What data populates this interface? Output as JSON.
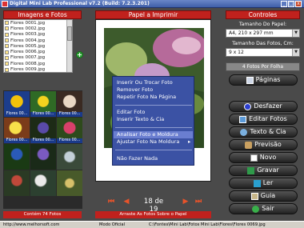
{
  "window": {
    "title": "Digital Mini Lab Professional v7.2 (Build: 7.2.3.201)",
    "btn_min": "_",
    "btn_max": "□",
    "btn_close": "x"
  },
  "left": {
    "header": "Imagens e Fotos",
    "files": [
      "Flores 0001.jpg",
      "Flores 0002.jpg",
      "Flores 0003.jpg",
      "Flores 0004.jpg",
      "Flores 0005.jpg",
      "Flores 0006.jpg",
      "Flores 0007.jpg",
      "Flores 0008.jpg",
      "Flores 0009.jpg"
    ],
    "thumb_captions": [
      "Flores 00...",
      "Flores 00...",
      "Flores 00...",
      "Flores 00...",
      "Flores 00...",
      "Flores 00..."
    ],
    "footer": "Contém 74 Fotos",
    "add_label": "+"
  },
  "center": {
    "header": "Papel a Imprimir",
    "context_menu": [
      "Inserir Ou Trocar Foto",
      "Remover Foto",
      "Repetir Foto Na Página",
      "Editar Foto",
      "Inserir Texto & Cia",
      "Analisar Foto e Moldura",
      "Ajustar Foto Na Moldura",
      "Não Fazer Nada"
    ],
    "submenu_arrow": "▸",
    "nav_first": "⏮",
    "nav_prev": "◀",
    "page_indicator": "18 de 19",
    "nav_next": "▶",
    "nav_last": "⏭",
    "footer": "Arraste As Fotos Sobre o Papel"
  },
  "right": {
    "header": "Controles",
    "paper_size_label": "Tamanho Do Papel:",
    "paper_size_value": "A4, 210 x 297 mm",
    "photo_size_label": "Tamanho Das Fotos, Cm:",
    "photo_size_value": "9 x 12",
    "photos_per_sheet": "4 Fotos Por Folha",
    "buttons": {
      "pages": "Páginas",
      "undo": "Desfazer",
      "edit_photos": "Editar Fotos",
      "text": "Texto & Cia",
      "preview": "Previsão",
      "new": "Novo",
      "save": "Gravar",
      "open": "Ler",
      "guide": "Guia",
      "exit": "Sair"
    }
  },
  "status": {
    "website": "http://www.melhorsoft.com",
    "mode": "Modo Oficial",
    "path": "C:\\Fontes\\Mini Lab\\Fotos Mini Lab\\Flores\\Flores 0069.jpg"
  },
  "colors": {
    "header_red": "#c0211d",
    "background": "#4a4a4a",
    "menu_blue": "#3b52a4",
    "nav_orange": "#e8532a"
  }
}
